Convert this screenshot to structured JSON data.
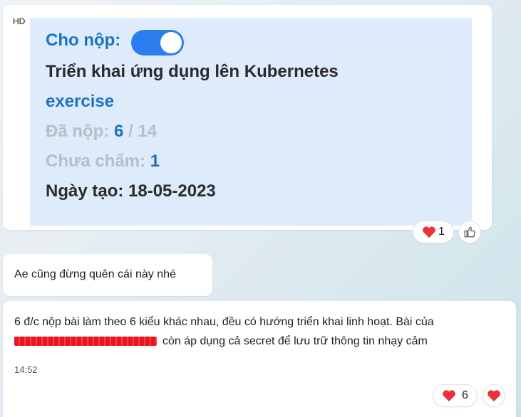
{
  "card": {
    "quality_badge": "HD",
    "submit_label": "Cho nộp:",
    "submit_enabled": true,
    "title": "Triển khai ứng dụng lên Kubernetes",
    "type": "exercise",
    "submitted_label": "Đã nộp:",
    "submitted_count": "6",
    "submitted_total": "/ 14",
    "ungraded_label": "Chưa chấm:",
    "ungraded_count": "1",
    "created_label": "Ngày tạo: 18-05-2023"
  },
  "card_reactions": {
    "heart_count": "1"
  },
  "messages": [
    {
      "text": "Ae cũng đừng quên cái này nhé"
    },
    {
      "line1": "6 đ/c nộp bài làm theo 6 kiểu khác nhau, đều có hướng triển khai linh hoạt. Bài của",
      "line2": "còn áp dụng cả secret để lưu trữ thông tin nhạy cảm",
      "time": "14:52",
      "heart_count": "6"
    }
  ],
  "colors": {
    "accent": "#1a73c4",
    "toggle": "#2a7ef0",
    "heart": "#e8323c",
    "redaction": "#e9141c"
  }
}
